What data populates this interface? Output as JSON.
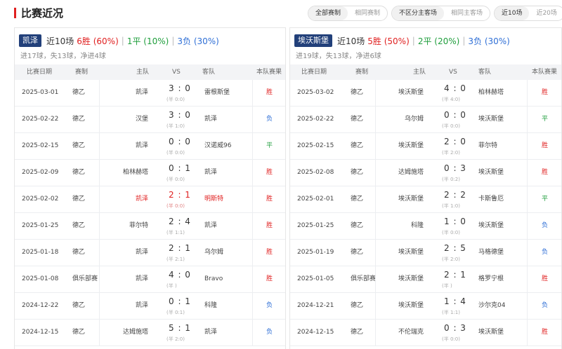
{
  "header": {
    "title": "比赛近况",
    "filter_comp": [
      "全部赛制",
      "相同赛制"
    ],
    "filter_venue": [
      "不区分主客场",
      "相同主客场"
    ],
    "filter_count": [
      "近10场",
      "近20场"
    ]
  },
  "colors": {
    "win": "#e02020",
    "draw": "#1f9e3c",
    "loss": "#2f6fd6",
    "badge": "#22407a",
    "accent": "#e02020"
  },
  "columns": {
    "date": "比赛日期",
    "comp": "赛制",
    "home": "主队",
    "vs": "VS",
    "away": "客队",
    "result": "本队赛果"
  },
  "left": {
    "team": "凯泽",
    "recent": "近10场",
    "wins": "6胜 (60%)",
    "draws": "1平 (10%)",
    "losses": "3负 (30%)",
    "sep1": "|",
    "sep2": "|",
    "goals": "进17球，失13球，净进4球",
    "matches": [
      {
        "date": "2025-03-01",
        "comp": "德乙",
        "home": "凯泽",
        "score": "3 : 0",
        "half": "(半 0:0)",
        "away": "雷根斯堡",
        "result": "胜",
        "type": "w"
      },
      {
        "date": "2025-02-22",
        "comp": "德乙",
        "home": "汉堡",
        "score": "3 : 0",
        "half": "(半 1:0)",
        "away": "凯泽",
        "result": "负",
        "type": "l"
      },
      {
        "date": "2025-02-15",
        "comp": "德乙",
        "home": "凯泽",
        "score": "0 : 0",
        "half": "(半 0:0)",
        "away": "汉诺威96",
        "result": "平",
        "type": "d"
      },
      {
        "date": "2025-02-09",
        "comp": "德乙",
        "home": "柏林赫塔",
        "score": "0 : 1",
        "half": "(半 0:0)",
        "away": "凯泽",
        "result": "胜",
        "type": "w"
      },
      {
        "date": "2025-02-02",
        "comp": "德乙",
        "home": "凯泽",
        "score": "2 : 1",
        "half": "(半 0:0)",
        "away": "明斯特",
        "result": "胜",
        "type": "w",
        "hl": true
      },
      {
        "date": "2025-01-25",
        "comp": "德乙",
        "home": "菲尔特",
        "score": "2 : 4",
        "half": "(半 1:1)",
        "away": "凯泽",
        "result": "胜",
        "type": "w"
      },
      {
        "date": "2025-01-18",
        "comp": "德乙",
        "home": "凯泽",
        "score": "2 : 1",
        "half": "(半 2:1)",
        "away": "乌尔姆",
        "result": "胜",
        "type": "w"
      },
      {
        "date": "2025-01-08",
        "comp": "俱乐部赛",
        "home": "凯泽",
        "score": "4 : 0",
        "half": "(半 )",
        "away": "Bravo",
        "result": "胜",
        "type": "w"
      },
      {
        "date": "2024-12-22",
        "comp": "德乙",
        "home": "凯泽",
        "score": "0 : 1",
        "half": "(半 0:1)",
        "away": "科隆",
        "result": "负",
        "type": "l"
      },
      {
        "date": "2024-12-15",
        "comp": "德乙",
        "home": "达姆施塔",
        "score": "5 : 1",
        "half": "(半 2:0)",
        "away": "凯泽",
        "result": "负",
        "type": "l"
      }
    ]
  },
  "right": {
    "team": "埃沃斯堡",
    "recent": "近10场",
    "wins": "5胜 (50%)",
    "draws": "2平 (20%)",
    "losses": "3负 (30%)",
    "sep1": "|",
    "sep2": "|",
    "goals": "进19球，失13球，净进6球",
    "matches": [
      {
        "date": "2025-03-02",
        "comp": "德乙",
        "home": "埃沃斯堡",
        "score": "4 : 0",
        "half": "(半 4:0)",
        "away": "柏林赫塔",
        "result": "胜",
        "type": "w"
      },
      {
        "date": "2025-02-22",
        "comp": "德乙",
        "home": "乌尔姆",
        "score": "0 : 0",
        "half": "(半 0:0)",
        "away": "埃沃斯堡",
        "result": "平",
        "type": "d"
      },
      {
        "date": "2025-02-15",
        "comp": "德乙",
        "home": "埃沃斯堡",
        "score": "2 : 0",
        "half": "(半 2:0)",
        "away": "菲尔特",
        "result": "胜",
        "type": "w"
      },
      {
        "date": "2025-02-08",
        "comp": "德乙",
        "home": "达姆施塔",
        "score": "0 : 3",
        "half": "(半 0:2)",
        "away": "埃沃斯堡",
        "result": "胜",
        "type": "w"
      },
      {
        "date": "2025-02-01",
        "comp": "德乙",
        "home": "埃沃斯堡",
        "score": "2 : 2",
        "half": "(半 1:0)",
        "away": "卡斯鲁厄",
        "result": "平",
        "type": "d"
      },
      {
        "date": "2025-01-25",
        "comp": "德乙",
        "home": "科隆",
        "score": "1 : 0",
        "half": "(半 0:0)",
        "away": "埃沃斯堡",
        "result": "负",
        "type": "l"
      },
      {
        "date": "2025-01-19",
        "comp": "德乙",
        "home": "埃沃斯堡",
        "score": "2 : 5",
        "half": "(半 2:0)",
        "away": "马格德堡",
        "result": "负",
        "type": "l"
      },
      {
        "date": "2025-01-05",
        "comp": "俱乐部赛",
        "home": "埃沃斯堡",
        "score": "2 : 1",
        "half": "(半 )",
        "away": "格罗宁根",
        "result": "胜",
        "type": "w"
      },
      {
        "date": "2024-12-21",
        "comp": "德乙",
        "home": "埃沃斯堡",
        "score": "1 : 4",
        "half": "(半 1:1)",
        "away": "沙尔克04",
        "result": "负",
        "type": "l"
      },
      {
        "date": "2024-12-15",
        "comp": "德乙",
        "home": "不伦瑞克",
        "score": "0 : 3",
        "half": "(半 0:0)",
        "away": "埃沃斯堡",
        "result": "胜",
        "type": "w"
      }
    ]
  }
}
